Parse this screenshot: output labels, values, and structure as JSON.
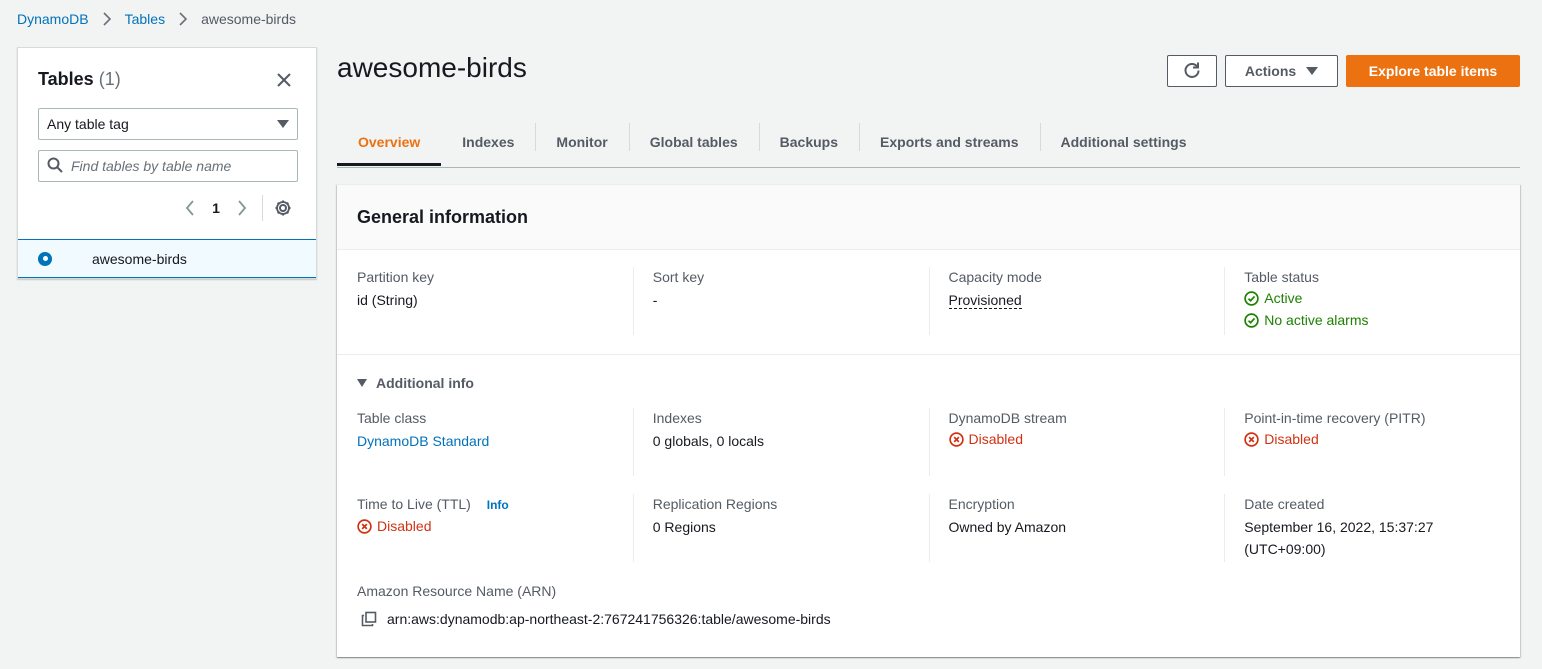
{
  "breadcrumb": {
    "items": [
      "DynamoDB",
      "Tables"
    ],
    "current": "awesome-birds"
  },
  "sidebar": {
    "title": "Tables",
    "count": "(1)",
    "tag_select_value": "Any table tag",
    "search_placeholder": "Find tables by table name",
    "page_number": "1",
    "tables": [
      {
        "name": "awesome-birds",
        "selected": true
      }
    ]
  },
  "header": {
    "title": "awesome-birds",
    "actions_label": "Actions",
    "primary_label": "Explore table items"
  },
  "tabs": [
    {
      "label": "Overview",
      "active": true
    },
    {
      "label": "Indexes"
    },
    {
      "label": "Monitor"
    },
    {
      "label": "Global tables"
    },
    {
      "label": "Backups"
    },
    {
      "label": "Exports and streams"
    },
    {
      "label": "Additional settings"
    }
  ],
  "general": {
    "title": "General information",
    "partition_key_label": "Partition key",
    "partition_key_value": "id (String)",
    "sort_key_label": "Sort key",
    "sort_key_value": "-",
    "capacity_mode_label": "Capacity mode",
    "capacity_mode_value": "Provisioned",
    "table_status_label": "Table status",
    "table_status_value": "Active",
    "alarms_value": "No active alarms"
  },
  "additional": {
    "toggle_label": "Additional info",
    "table_class_label": "Table class",
    "table_class_value": "DynamoDB Standard",
    "indexes_label": "Indexes",
    "indexes_value": "0 globals, 0 locals",
    "stream_label": "DynamoDB stream",
    "stream_value": "Disabled",
    "pitr_label": "Point-in-time recovery (PITR)",
    "pitr_value": "Disabled",
    "ttl_label": "Time to Live (TTL)",
    "ttl_info": "Info",
    "ttl_value": "Disabled",
    "replication_label": "Replication Regions",
    "replication_value": "0 Regions",
    "encryption_label": "Encryption",
    "encryption_value": "Owned by Amazon",
    "date_label": "Date created",
    "date_value_line1": "September 16, 2022, 15:37:27",
    "date_value_line2": "(UTC+09:00)",
    "arn_label": "Amazon Resource Name (ARN)",
    "arn_value": "arn:aws:dynamodb:ap-northeast-2:767241756326:table/awesome-birds"
  },
  "colors": {
    "accent": "#ec7211",
    "link": "#0073bb",
    "success": "#1d8102",
    "error": "#d13212"
  }
}
